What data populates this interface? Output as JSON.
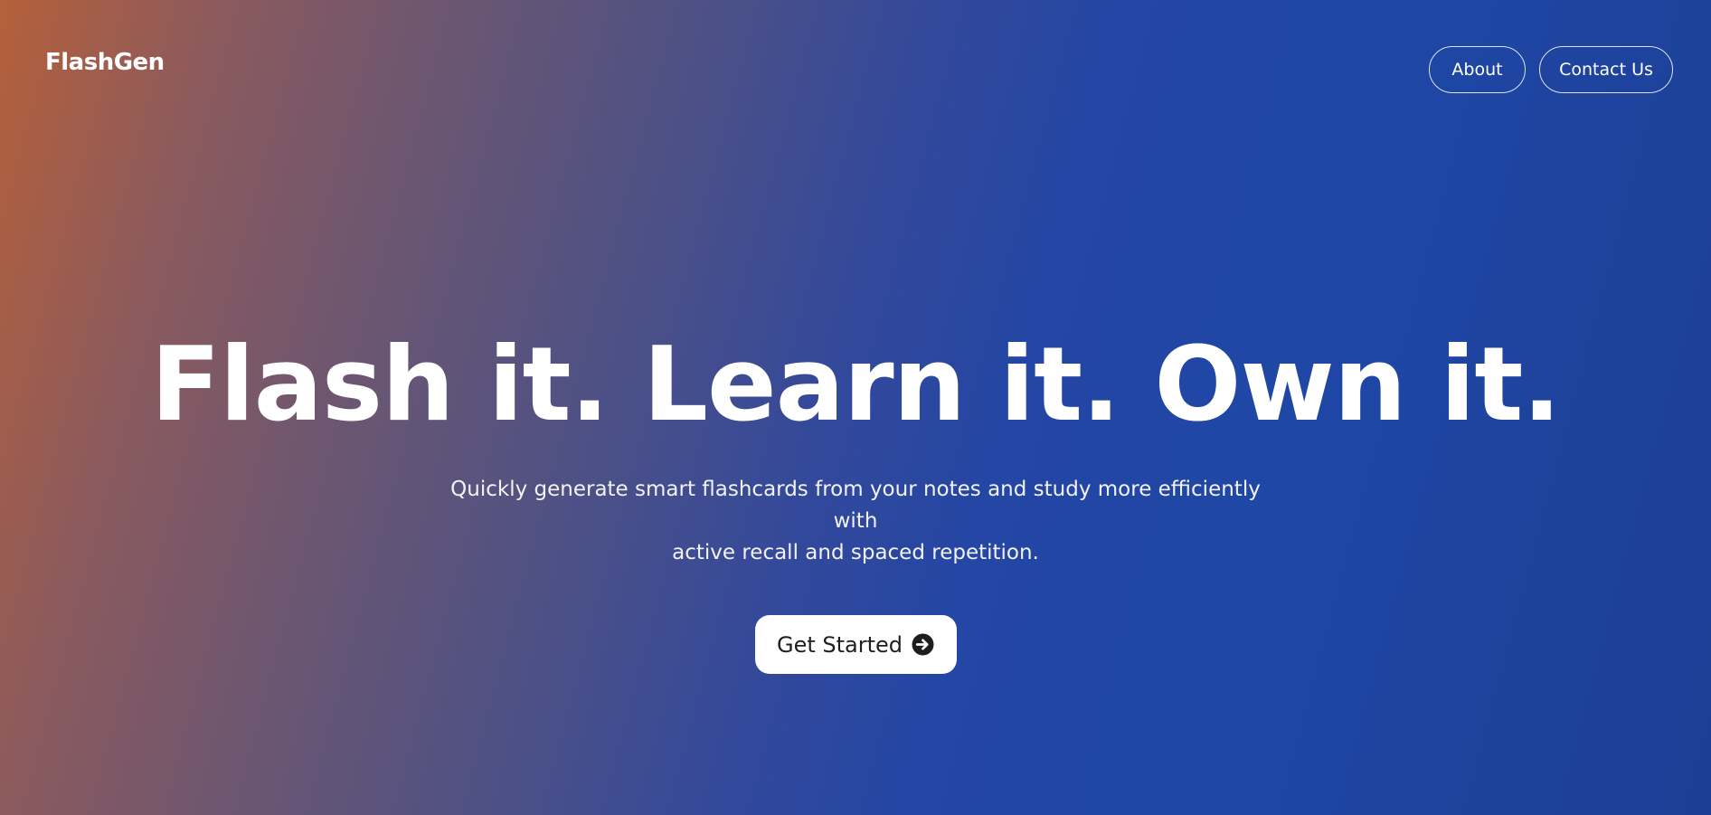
{
  "nav": {
    "logo": "FlashGen",
    "links": [
      {
        "label": "About"
      },
      {
        "label": "Contact Us"
      }
    ]
  },
  "hero": {
    "headline": "Flash it. Learn it. Own it.",
    "subtitle_line1": "Quickly generate smart flashcards from your notes and study more efficiently with",
    "subtitle_line2": "active recall and spaced repetition.",
    "cta_label": "Get Started",
    "cta_icon": "arrow-circle-right-icon"
  },
  "colors": {
    "gradient_start": "#b5603a",
    "gradient_mid": "#2446a4",
    "gradient_end": "#1c3f95",
    "text": "#ffffff",
    "cta_bg": "#ffffff",
    "cta_text": "#1e1e1e"
  }
}
